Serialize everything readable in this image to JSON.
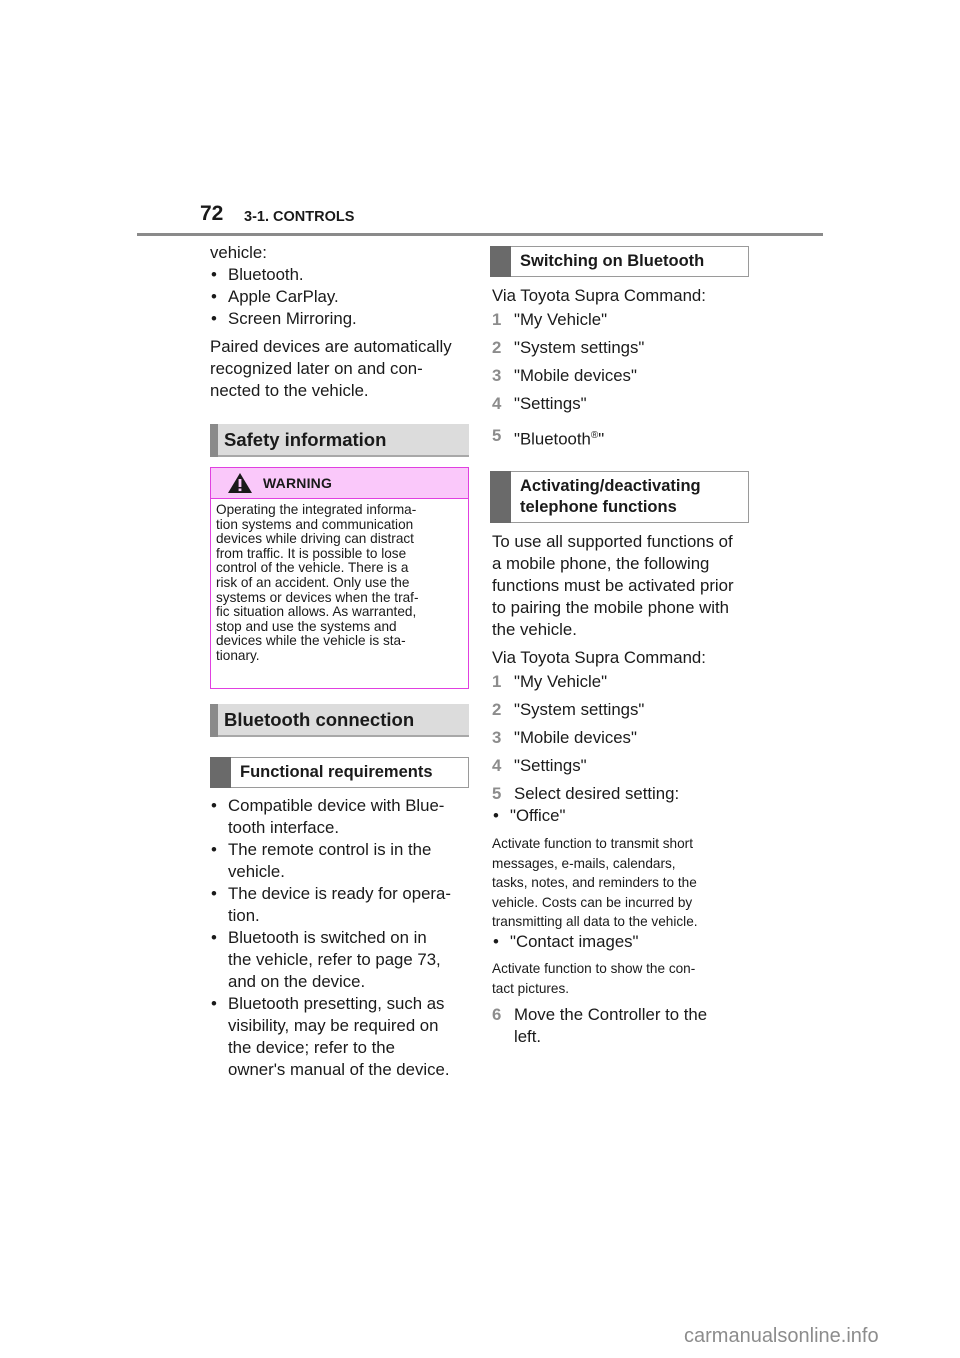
{
  "header": {
    "page_number": "72",
    "section": "3-1. CONTROLS"
  },
  "left_column": {
    "intro_lead": "vehicle:",
    "intro_bullets": [
      "Bluetooth.",
      "Apple CarPlay.",
      "Screen Mirroring."
    ],
    "paired_text_lines": [
      "Paired devices are automatically",
      "recognized later on and con-",
      "nected to the vehicle."
    ],
    "safety_heading": "Safety information",
    "warning": {
      "icon": "warning-triangle-icon",
      "label": "WARNING",
      "lines": [
        "Operating the integrated informa-",
        "tion systems and communication",
        "devices while driving can distract",
        "from traffic. It is possible to lose",
        "control of the vehicle. There is a",
        "risk of an accident. Only use the",
        "systems or devices when the traf-",
        "fic situation allows. As warranted,",
        "stop and use the systems and",
        "devices while the vehicle is sta-",
        "tionary."
      ]
    },
    "bluetooth_heading": "Bluetooth connection",
    "functional_heading": "Functional requirements",
    "requirements": [
      [
        "Compatible device with Blue-",
        "tooth interface."
      ],
      [
        "The remote control is in the",
        "vehicle."
      ],
      [
        "The device is ready for opera-",
        "tion."
      ],
      [
        "Bluetooth is switched on in",
        "the vehicle, refer to page 73,",
        "and on the device."
      ],
      [
        "Bluetooth presetting, such as",
        "visibility, may be required on",
        "the device; refer to the",
        "owner's manual of the device."
      ]
    ]
  },
  "right_column": {
    "switching_heading": "Switching on Bluetooth",
    "switching_lead": "Via Toyota Supra Command:",
    "switching_steps": [
      {
        "num": "1",
        "text": "\"My Vehicle\""
      },
      {
        "num": "2",
        "text": "\"System settings\""
      },
      {
        "num": "3",
        "text": "\"Mobile devices\""
      },
      {
        "num": "4",
        "text": "\"Settings\""
      },
      {
        "num": "5",
        "text": "\"Bluetooth",
        "sup": "®",
        "tail": "\""
      }
    ],
    "activating_heading_lines": [
      "Activating/deactivating",
      "telephone functions"
    ],
    "activating_text_lines": [
      "To use all supported functions of",
      "a mobile phone, the following",
      "functions must be activated prior",
      "to pairing the mobile phone with",
      "the vehicle."
    ],
    "activating_lead": "Via Toyota Supra Command:",
    "activating_steps": [
      {
        "num": "1",
        "text": "\"My Vehicle\""
      },
      {
        "num": "2",
        "text": "\"System settings\""
      },
      {
        "num": "3",
        "text": "\"Mobile devices\""
      },
      {
        "num": "4",
        "text": "\"Settings\""
      },
      {
        "num": "5",
        "text": "Select desired setting:"
      }
    ],
    "office_bullet": "\"Office\"",
    "office_desc_lines": [
      "Activate function to transmit short",
      "messages, e-mails, calendars,",
      "tasks, notes, and reminders to the",
      "vehicle. Costs can be incurred by",
      "transmitting all data to the vehicle."
    ],
    "contact_bullet": "\"Contact images\"",
    "contact_desc_lines": [
      "Activate function to show the con-",
      "tact pictures."
    ],
    "step6": {
      "num": "6",
      "lines": [
        "Move the Controller to the",
        "left."
      ]
    }
  },
  "watermark": "carmanualsonline.info"
}
